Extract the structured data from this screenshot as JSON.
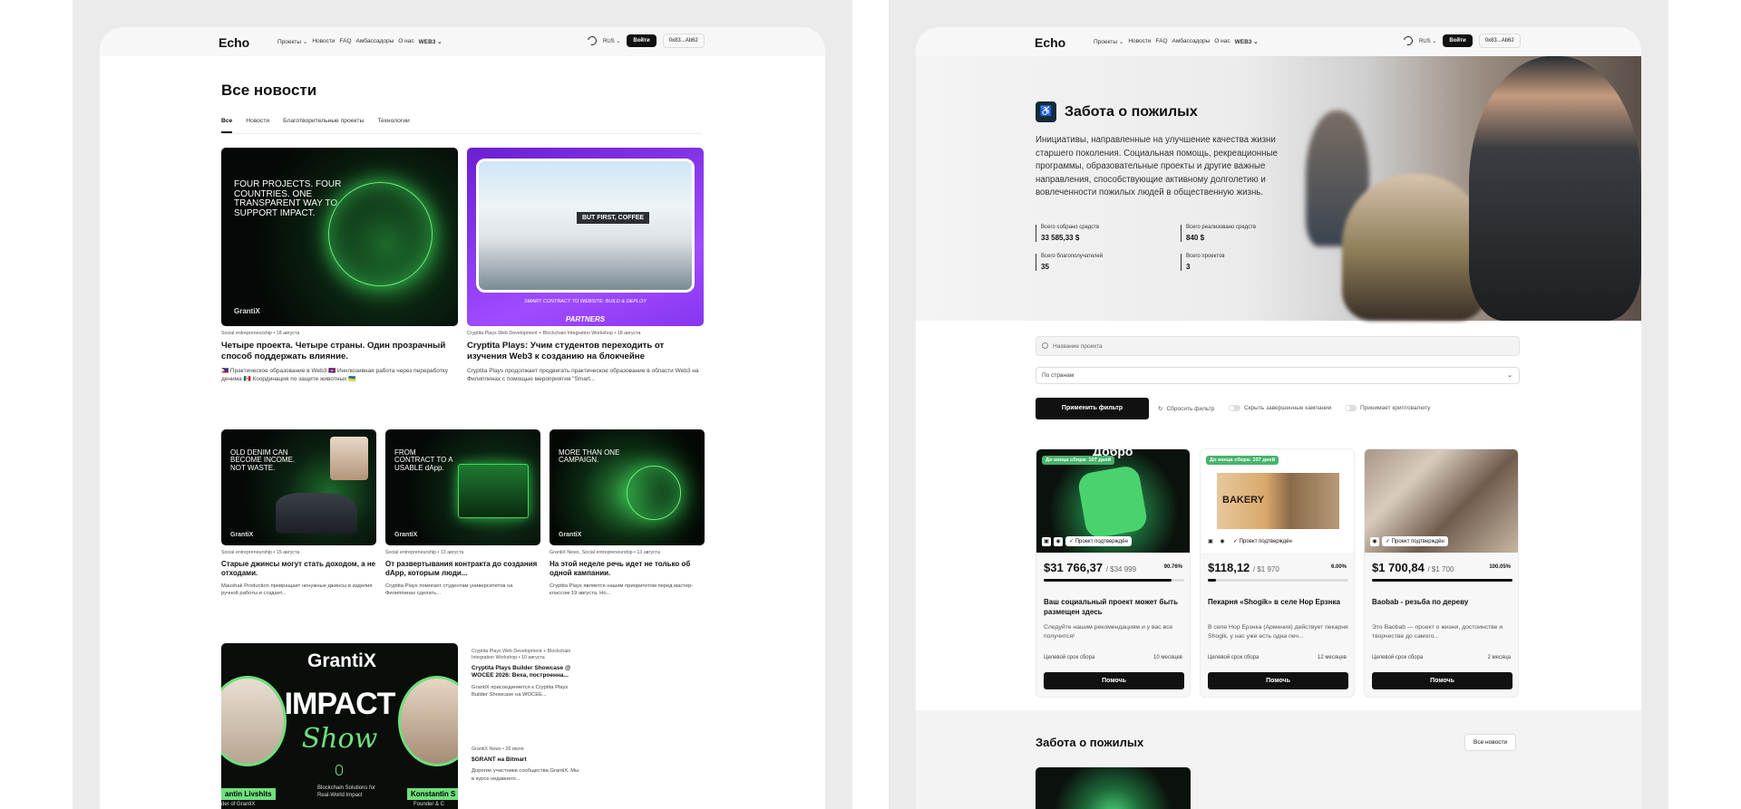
{
  "left": {
    "logo": "Echo",
    "nav": {
      "projects": "Проекты ⌄",
      "news": "Новости",
      "faq": "FAQ",
      "ambassadors": "Амбассадоры",
      "about": "О нас",
      "web3": "WEB3 ⌄"
    },
    "lang": "RUS ⌄",
    "login": "Войти",
    "wallet": "0x83...Ab62",
    "page_title": "Все новости",
    "tabs": [
      "Все",
      "Новости",
      "Благотворительные проекты",
      "Технологии"
    ],
    "articles": [
      {
        "meta": "Social entrepreneurship  •  18 августа",
        "title": "Четыре проекта. Четыре страны. Один прозрачный способ поддержать влияние.",
        "excerpt": "🇵🇭 Практическое образование в Web3  🇰🇭 Инклюзивная работа через переработку денима  🇲🇽 Координация по защите животных  🇺🇦",
        "thumb_text": "FOUR PROJECTS. FOUR COUNTRIES. ONE TRANSPARENT WAY TO SUPPORT IMPACT.",
        "brand": "GrantiX"
      },
      {
        "meta": "Cryptita Plays Web Development + Blockchain Integration Workshop  •  18 августа",
        "title": "Cryptita Plays: Учим студентов переходить от изучения Web3 к созданию на блокчейне",
        "excerpt": "Cryptita Plays продолжает продвигать практическое образование в области Web3 на Филиппинах с помощью мероприятия \"Smart...",
        "thumb_text": "SMART CONTRACT TO WEBSITE: BUILD & DEPLOY",
        "thumb_text2": "PARTNERS",
        "store_sign": "BUT FIRST, COFFEE"
      },
      {
        "meta": "Social entrepreneurship  •  15 августа",
        "title": "Старые джинсы могут стать доходом, а не отходами.",
        "excerpt": "Maushak Production превращает ненужные джинсы в изделия ручной работы и создает...",
        "thumb_text": "OLD DENIM CAN BECOME INCOME. NOT WASTE.",
        "brand": "GrantiX"
      },
      {
        "meta": "Social entrepreneurship  •  13 августа",
        "title": "От развертывания контракта до создания dApp, которым люди...",
        "excerpt": "Cryptita Plays помогает студентам университетов на Филиппинах сделать...",
        "thumb_text": "FROM CONTRACT TO A USABLE dApp.",
        "brand": "GrantiX"
      },
      {
        "meta": "GrantiX News, Social entrepreneurship  •  13 августа",
        "title": "На этой неделе речь идет не только об одной кампании.",
        "excerpt": "Cryptita Plays является нашим приоритетом перед мастер-классом 19 августа. Но...",
        "thumb_text": "MORE THAN ONE CAMPAIGN.",
        "brand": "GrantiX"
      },
      {
        "meta": "Cryptita Plays Web Development + Blockchain Integration Workshop  •  10 августа",
        "title": "Cryptita Plays Builder Showcase @ WOCEE 2026: Веха, построенна...",
        "excerpt": "GrantiX присоединяется к Cryptita Plays Builder Showcase на WOCEE..."
      },
      {
        "meta": "GrantiX News  •  26 июля",
        "title": "$GRANT на Bitmart",
        "excerpt": "Дорогие участники сообщества GrantiX. Мы в курсе недавнего..."
      }
    ],
    "impact": {
      "brand": "GrantiX",
      "big": "IMPACT",
      "script": "Show",
      "left_name": "antin Livshits",
      "left_role": "der of GrantiX",
      "right_name": "Konstantin S",
      "right_role": "Founder & C",
      "tagline": "Blockchain Solutions for Real-World Impact"
    }
  },
  "right": {
    "logo": "Echo",
    "nav": {
      "projects": "Проекты ⌄",
      "news": "Новости",
      "faq": "FAQ",
      "ambassadors": "Амбассадоры",
      "about": "О нас",
      "web3": "WEB3 ⌄"
    },
    "lang": "RUS ⌄",
    "login": "Войти",
    "wallet": "0x83...Ab62",
    "hero": {
      "title": "Забота о пожилых",
      "description": "Инициативы, направленные на улучшение качества жизни старшего поколения. Социальная помощь, рекреационные программы, образовательные проекты и другие важные направления, способствующие активному долголетию и вовлеченности пожилых людей в общественную жизнь.",
      "stats": [
        {
          "label": "Всего собрано средств",
          "value": "33 585,33 $"
        },
        {
          "label": "Всего реализовано средств",
          "value": "840 $"
        },
        {
          "label": "Всего благополучателей",
          "value": "35"
        },
        {
          "label": "Всего проектов",
          "value": "3"
        }
      ]
    },
    "filters": {
      "search_placeholder": "Название проекта",
      "country": "По странам",
      "apply": "Применить фильтр",
      "reset": "Сбросить фильтр",
      "hide_completed": "Скрыть завершенные кампании",
      "crypto": "Принимает криптовалюту"
    },
    "projects": [
      {
        "badge": "До конца сбора: 107 дней",
        "verified": "✓ Проект подтверждён",
        "raised": "$31 766,37",
        "goal": "/ $34 999",
        "percent": "90.76%",
        "progress": 0.9076,
        "title": "Ваш социальный проект может быть размещен здесь",
        "desc": "Следуйте нашим рекомендациям и у вас все получится!",
        "term_label": "Целевой срок сбора",
        "term": "10 месяцев",
        "help": "Помочь",
        "img_text": "Добро"
      },
      {
        "badge": "До конца сбора: 107 дней",
        "verified": "✓ Проект подтверждён",
        "raised": "$118,12",
        "goal": "/ $1 970",
        "percent": "6.00%",
        "progress": 0.06,
        "title": "Пекарня «Shogik» в селе Нор Ерзнка",
        "desc": "В селе Нор Ерзнка (Армения) действует пекарня Shogik, у нас уже есть одна печ...",
        "term_label": "Целевой срок сбора",
        "term": "12 месяцев",
        "help": "Помочь",
        "img_text": "BAKERY"
      },
      {
        "badge": "",
        "verified": "✓ Проект подтверждён",
        "raised": "$1 700,84",
        "goal": "/ $1 700",
        "percent": "100.05%",
        "progress": 1.0,
        "title": "Baobab - резьба по дереву",
        "desc": "Это Baobab — проект о жизни, достоинстве и творчестве до самого...",
        "term_label": "Целевой срок сбора",
        "term": "2 месяца",
        "help": "Помочь"
      }
    ],
    "section2": {
      "title": "Забота о пожилых",
      "button": "Все новости"
    }
  }
}
